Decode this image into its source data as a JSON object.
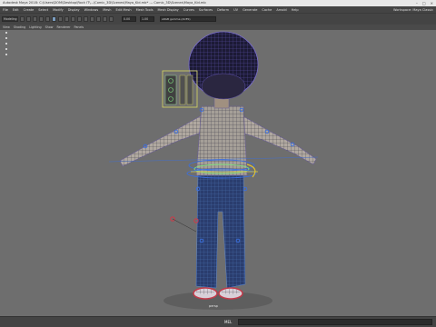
{
  "window": {
    "title": "Autodesk Maya 2018: C:\\Users\\DOM\\Desktop\\Rock IT\\...\\Comic_3D\\Scenes\\Maya_Kid.mb*  ---  Comic_3D\\Scenes\\Maya_Kid.mb"
  },
  "menubar": {
    "items": [
      "File",
      "Edit",
      "Create",
      "Select",
      "Modify",
      "Display",
      "Windows",
      "Mesh",
      "Edit Mesh",
      "Mesh Tools",
      "Mesh Display",
      "Curves",
      "Surfaces",
      "Deform",
      "UV",
      "Generate",
      "Cache",
      "Arnold",
      "Help"
    ],
    "workspace": "Workspace: Maya Classic"
  },
  "statusline": {
    "mode": "Modeling",
    "frame_value": "0.00",
    "scale_value": "1.00",
    "renderer": "sRGB gamma (ACES)"
  },
  "panel_menu": {
    "items": [
      "View",
      "Shading",
      "Lighting",
      "Show",
      "Renderer",
      "Panels"
    ]
  },
  "viewport": {
    "camera_label": "persp"
  },
  "bottombar": {
    "mel_label": "MEL"
  }
}
